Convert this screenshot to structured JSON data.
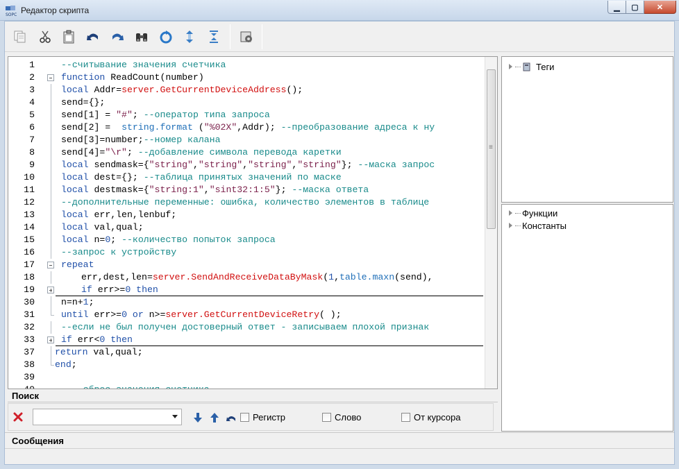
{
  "window": {
    "title": "Редактор скрипта",
    "buttons": {
      "minimize": "▁",
      "maximize": "▢",
      "close": "✕"
    }
  },
  "toolbar": {
    "items": [
      {
        "name": "copy-icon"
      },
      {
        "name": "cut-icon"
      },
      {
        "name": "paste-icon"
      },
      {
        "name": "undo-icon"
      },
      {
        "name": "redo-icon"
      },
      {
        "name": "find-icon"
      },
      {
        "name": "refresh-icon"
      },
      {
        "name": "expand-icon"
      },
      {
        "name": "collapse-icon"
      },
      {
        "name": "compile-icon"
      }
    ]
  },
  "editor": {
    "lines": [
      {
        "n": "1",
        "indent": "",
        "html": "<span class='c-cm'>--считывание значения счетчика</span>"
      },
      {
        "n": "2",
        "fold": "minus",
        "html": "<span class='c-kw'>function</span> ReadCount(number)"
      },
      {
        "n": "3",
        "vline": true,
        "html": "<span class='c-kw'>local</span> Addr=<span class='c-fn'>server.GetCurrentDeviceAddress</span>();"
      },
      {
        "n": "4",
        "vline": true,
        "html": "send={};"
      },
      {
        "n": "5",
        "vline": true,
        "html": "send[1] = <span class='c-str'>\"#\"</span>; <span class='c-cm'>--оператор типа запроса</span>"
      },
      {
        "n": "6",
        "vline": true,
        "html": "send[2] =  <span class='c-lib'>string.format</span> (<span class='c-str'>\"%02X\"</span>,Addr); <span class='c-cm'>--преобразование адреса к ну</span>"
      },
      {
        "n": "7",
        "vline": true,
        "html": "send[3]=number;<span class='c-cm'>--номер калана</span>"
      },
      {
        "n": "8",
        "vline": true,
        "html": "send[4]=<span class='c-str'>\"\\r\"</span>; <span class='c-cm'>--добавление символа перевода каретки</span>"
      },
      {
        "n": "9",
        "vline": true,
        "html": "<span class='c-kw'>local</span> sendmask={<span class='c-str'>\"string\"</span>,<span class='c-str'>\"string\"</span>,<span class='c-str'>\"string\"</span>,<span class='c-str'>\"string\"</span>}; <span class='c-cm'>--маска запрос</span>"
      },
      {
        "n": "10",
        "vline": true,
        "html": "<span class='c-kw'>local</span> dest={}; <span class='c-cm'>--таблица принятых значений по маске</span>"
      },
      {
        "n": "11",
        "vline": true,
        "html": "<span class='c-kw'>local</span> destmask={<span class='c-str'>\"string:1\"</span>,<span class='c-str'>\"sint32:1:5\"</span>}; <span class='c-cm'>--маска ответа</span>"
      },
      {
        "n": "12",
        "vline": true,
        "html": "<span class='c-cm'>--дополнительные переменные: ошибка, количество элементов в таблице</span>"
      },
      {
        "n": "13",
        "vline": true,
        "html": "<span class='c-kw'>local</span> err,len,lenbuf;"
      },
      {
        "n": "14",
        "vline": true,
        "html": "<span class='c-kw'>local</span> val,qual;"
      },
      {
        "n": "15",
        "vline": true,
        "html": "<span class='c-kw'>local</span> n=<span class='c-num'>0</span>; <span class='c-cm'>--количество попыток запроса</span>"
      },
      {
        "n": "16",
        "vline": true,
        "html": "<span class='c-cm'>--запрос к устройству</span>"
      },
      {
        "n": "17",
        "fold": "minus",
        "html": "<span class='c-kw'>repeat</span>"
      },
      {
        "n": "18",
        "vline": true,
        "indent": "ind1",
        "html": "err,dest,len=<span class='c-fn'>server.SendAndReceiveDataByMask</span>(<span class='c-num'>1</span>,<span class='c-lib'>table.maxn</span>(send),"
      },
      {
        "n": "19",
        "fold": "plus",
        "indent": "ind1",
        "underline": true,
        "html": "<span class='c-kw'>if</span> err&gt;=<span class='c-num'>0</span> <span class='c-kw'>then</span>"
      },
      {
        "n": "30",
        "vline": true,
        "html": "n=n+<span class='c-num'>1</span>;"
      },
      {
        "n": "31",
        "tick": true,
        "html": "<span class='c-kw'>until</span> err&gt;=<span class='c-num'>0</span> <span class='c-kw'>or</span> n&gt;=<span class='c-fn'>server.GetCurrentDeviceRetry</span>( );"
      },
      {
        "n": "32",
        "vline": true,
        "html": "<span class='c-cm'>--если не был получен достоверный ответ - записываем плохой признак</span>"
      },
      {
        "n": "33",
        "fold": "plus",
        "underline": true,
        "html": "<span class='c-kw'>if</span> err&lt;<span class='c-num'>0</span> <span class='c-kw'>then</span>"
      },
      {
        "n": "37",
        "vline": true,
        "indent": "ind0",
        "html": "<span class='c-kw'>return</span> val,qual;"
      },
      {
        "n": "38",
        "tick": true,
        "indent": "ind0",
        "html": "<span class='c-kw'>end</span>;"
      },
      {
        "n": "39",
        "html": ""
      },
      {
        "n": "40",
        "html": "<span class='c-cm'>  --сброс значения счетчика</span>"
      }
    ]
  },
  "search": {
    "header": "Поиск",
    "input_value": "",
    "options": {
      "case": "Регистр",
      "word": "Слово",
      "from_cursor": "От курсора"
    }
  },
  "tree_top": {
    "items": [
      {
        "label": "Теги"
      }
    ]
  },
  "tree_bottom": {
    "items": [
      {
        "label": "Функции"
      },
      {
        "label": "Константы"
      }
    ]
  },
  "messages": {
    "header": "Сообщения"
  }
}
